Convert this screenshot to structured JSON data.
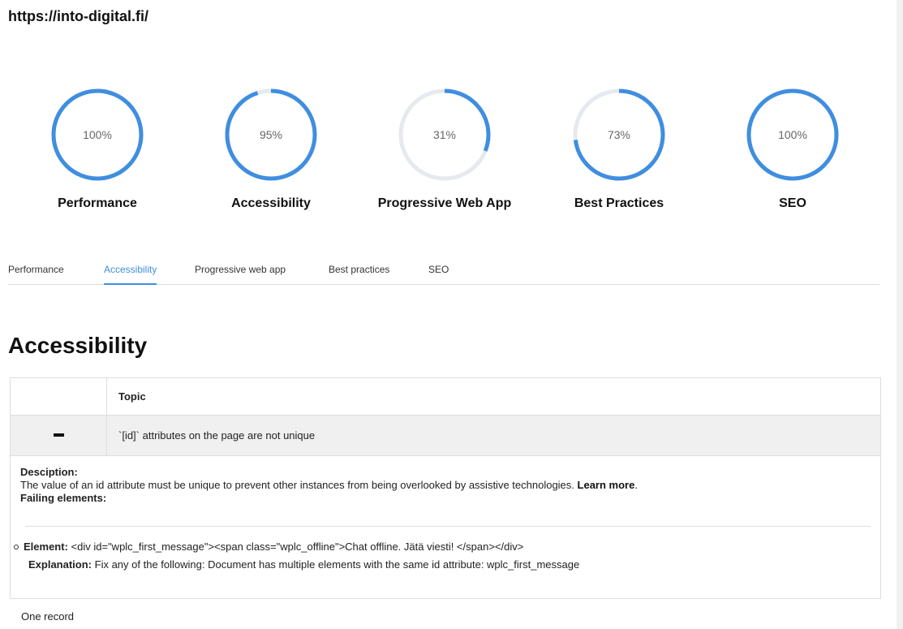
{
  "url": "https://into-digital.fi/",
  "accent_color": "#3f8ee0",
  "track_color": "#e6e9ee",
  "gauges": [
    {
      "label": "Performance",
      "percent_text": "100%",
      "value": 100
    },
    {
      "label": "Accessibility",
      "percent_text": "95%",
      "value": 95
    },
    {
      "label": "Progressive Web App",
      "percent_text": "31%",
      "value": 31
    },
    {
      "label": "Best Practices",
      "percent_text": "73%",
      "value": 73
    },
    {
      "label": "SEO",
      "percent_text": "100%",
      "value": 100
    }
  ],
  "tabs": [
    "Performance",
    "Accessibility",
    "Progressive web app",
    "Best practices",
    "SEO"
  ],
  "active_tab": "Accessibility",
  "section_title": "Accessibility",
  "table": {
    "header_topic": "Topic",
    "row": {
      "toggle_icon": "minus-icon",
      "topic": "`[id]` attributes on the page are not unique"
    },
    "details": {
      "description_label": "Desciption:",
      "description_text": "The value of an id attribute must be unique to prevent other instances from being overlooked by assistive technologies.",
      "learn_more": "Learn more",
      "learn_more_suffix": ".",
      "failing_label": "Failing elements:",
      "element_label": "Element:",
      "element_value": "<div id=\"wplc_first_message\"><span class=\"wplc_offline\">Chat offline. Jätä viesti! </span></div>",
      "explanation_label": "Explanation:",
      "explanation_value": "Fix any of the following: Document has multiple elements with the same id attribute: wplc_first_message"
    }
  },
  "footer": "One record"
}
